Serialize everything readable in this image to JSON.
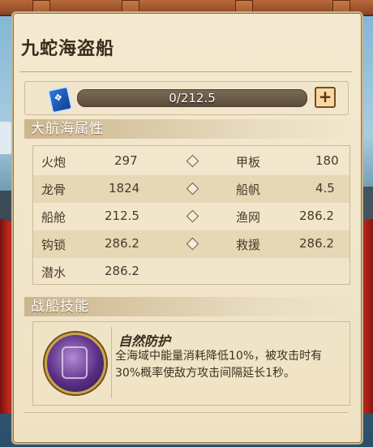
{
  "title": "九蛇海盗船",
  "progress": {
    "text": "0/212.5",
    "fraction": 0,
    "plus": "+"
  },
  "sections": {
    "attributes": "大航海属性",
    "skills": "战船技能"
  },
  "attributes": [
    {
      "left_label": "火炮",
      "left_value": "297",
      "right_label": "甲板",
      "right_value": "180"
    },
    {
      "left_label": "龙骨",
      "left_value": "1824",
      "right_label": "船帆",
      "right_value": "4.5"
    },
    {
      "left_label": "船舱",
      "left_value": "212.5",
      "right_label": "渔网",
      "right_value": "286.2"
    },
    {
      "left_label": "钩锁",
      "left_value": "286.2",
      "right_label": "救援",
      "right_value": "286.2"
    },
    {
      "left_label": "潜水",
      "left_value": "286.2"
    }
  ],
  "skill": {
    "name": "自然防护",
    "description": "全海域中能量消耗降低10%，被攻击时有30%概率使敌方攻击间隔延长1秒。"
  },
  "icons": {
    "gem": "blue-gem-icon",
    "plus": "plus-icon",
    "skill": "skill-rune-icon"
  }
}
